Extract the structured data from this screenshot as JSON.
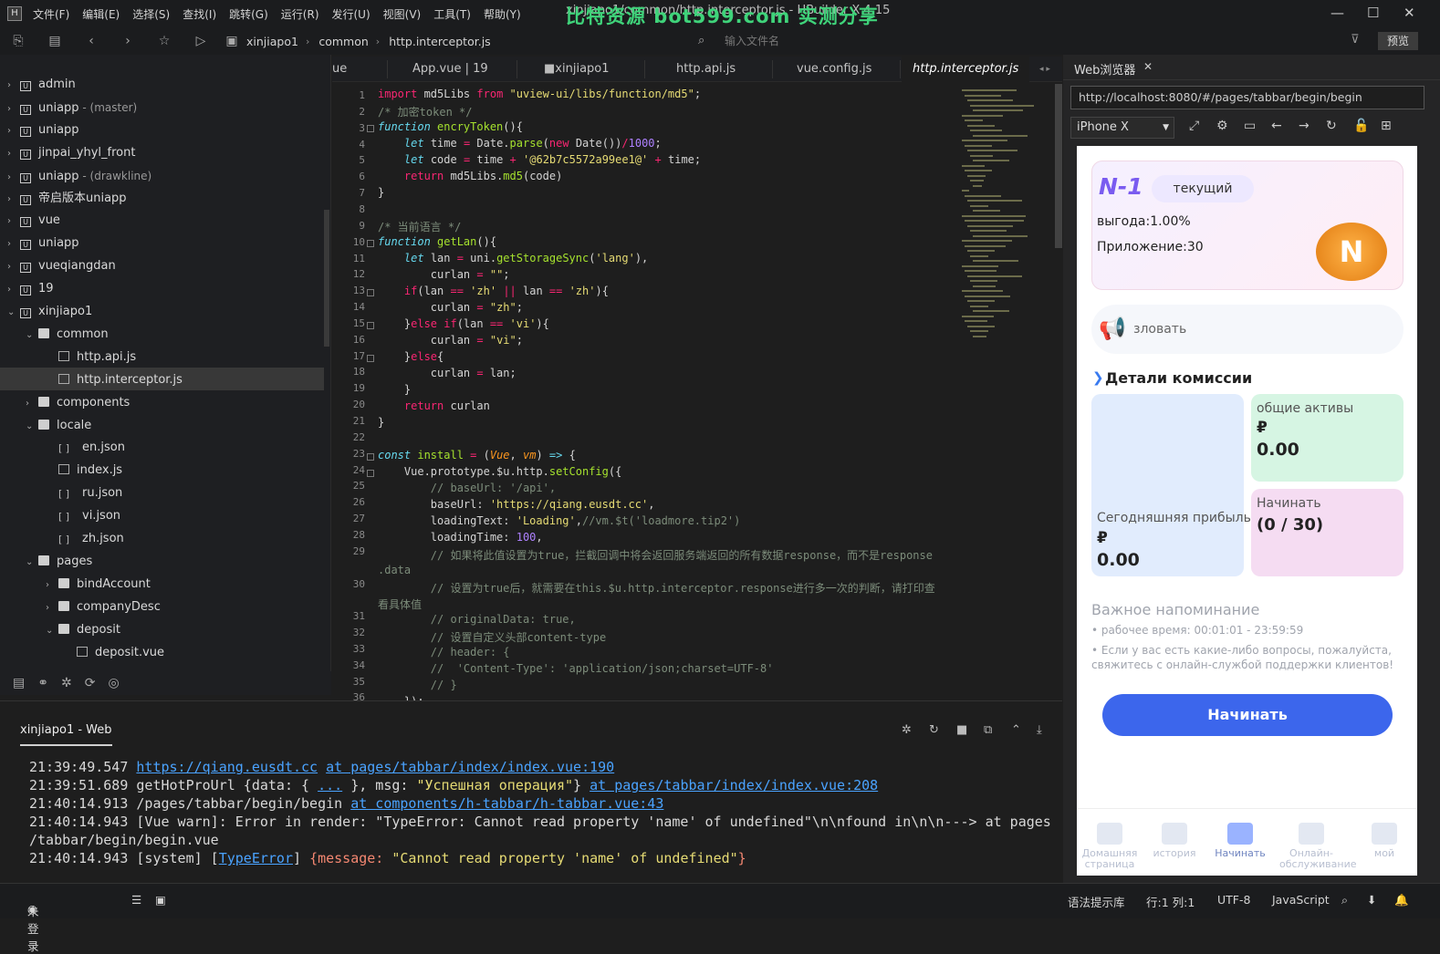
{
  "menubar": {
    "menus": [
      "文件(F)",
      "编辑(E)",
      "选择(S)",
      "查找(I)",
      "跳转(G)",
      "运行(R)",
      "发行(U)",
      "视图(V)",
      "工具(T)",
      "帮助(Y)"
    ],
    "title": "xinjiapo1/common/http.interceptor.js - HBuilder X 4.15",
    "watermark": "比特资源  bot599.com  实测分享"
  },
  "toolbar": {
    "breadcrumb": [
      "xinjiapo1",
      "common",
      "http.interceptor.js"
    ],
    "file_search_placeholder": "输入文件名",
    "preview": "预览"
  },
  "sidebar": {
    "items": [
      {
        "label": "admin",
        "branch": ""
      },
      {
        "label": "uniapp",
        "branch": " - (master)"
      },
      {
        "label": "uniapp",
        "branch": ""
      },
      {
        "label": "jinpai_yhyl_front",
        "branch": ""
      },
      {
        "label": "uniapp",
        "branch": " - (drawkline)"
      },
      {
        "label": "帝启版本uniapp",
        "branch": ""
      },
      {
        "label": "vue",
        "branch": ""
      },
      {
        "label": "uniapp",
        "branch": ""
      },
      {
        "label": "vueqiangdan",
        "branch": ""
      },
      {
        "label": "19",
        "branch": ""
      },
      {
        "label": "xinjiapo1",
        "branch": ""
      },
      {
        "label": "common",
        "branch": ""
      },
      {
        "label": "http.api.js",
        "branch": ""
      },
      {
        "label": "http.interceptor.js",
        "branch": ""
      },
      {
        "label": "components",
        "branch": ""
      },
      {
        "label": "locale",
        "branch": ""
      },
      {
        "label": "en.json",
        "branch": ""
      },
      {
        "label": "index.js",
        "branch": ""
      },
      {
        "label": "ru.json",
        "branch": ""
      },
      {
        "label": "vi.json",
        "branch": ""
      },
      {
        "label": "zh.json",
        "branch": ""
      },
      {
        "label": "pages",
        "branch": ""
      },
      {
        "label": "bindAccount",
        "branch": ""
      },
      {
        "label": "companyDesc",
        "branch": ""
      },
      {
        "label": "deposit",
        "branch": ""
      },
      {
        "label": "deposit.vue",
        "branch": ""
      }
    ]
  },
  "tabs": [
    "ue",
    "App.vue | 19",
    "xinjiapo1",
    "http.api.js",
    "vue.config.js",
    "http.interceptor.js"
  ],
  "editor": {
    "line_numbers": [
      "1",
      "2",
      "3",
      "4",
      "5",
      "6",
      "7",
      "8",
      "9",
      "10",
      "11",
      "12",
      "13",
      "14",
      "15",
      "16",
      "17",
      "18",
      "19",
      "20",
      "21",
      "22",
      "23",
      "24",
      "25",
      "26",
      "27",
      "28",
      "29",
      "",
      "30",
      "",
      "31",
      "32",
      "33",
      "34",
      "35",
      "36"
    ]
  },
  "browser": {
    "tab_label": "Web浏览器",
    "url": "http://localhost:8080/#/pages/tabbar/begin/begin",
    "device": "iPhone X"
  },
  "phone": {
    "level": "N-1",
    "current": "текущий",
    "profit": "выгода:1.00%",
    "app": "Приложение:30",
    "notice": "зловать",
    "section": "Детали комиссии",
    "card1_label": "Сегодняшняя прибыль",
    "card1_cur": "₽",
    "card1_val": "0.00",
    "card2_label": "общие активы",
    "card2_cur": "₽",
    "card2_val": "0.00",
    "card3_label": "Начинать",
    "card3_val": "(0 / 30)",
    "reminder_title": "Важное напоминание",
    "reminder_1": "• рабочее время: 00:01:01 - 23:59:59",
    "reminder_2": "• Если у вас есть какие-либо вопросы, пожалуйста,",
    "reminder_3": "свяжитесь с онлайн-службой поддержки клиентов!",
    "start_button": "Начинать",
    "nav": [
      "Домашняя страница",
      "история",
      "Начинать",
      "Онлайн-обслуживание",
      "мой"
    ]
  },
  "console": {
    "tab": "xinjiapo1 - Web"
  },
  "status": {
    "login": "未登录",
    "hint": "语法提示库",
    "pos": "行:1  列:1",
    "enc": "UTF-8",
    "lang": "JavaScript"
  }
}
